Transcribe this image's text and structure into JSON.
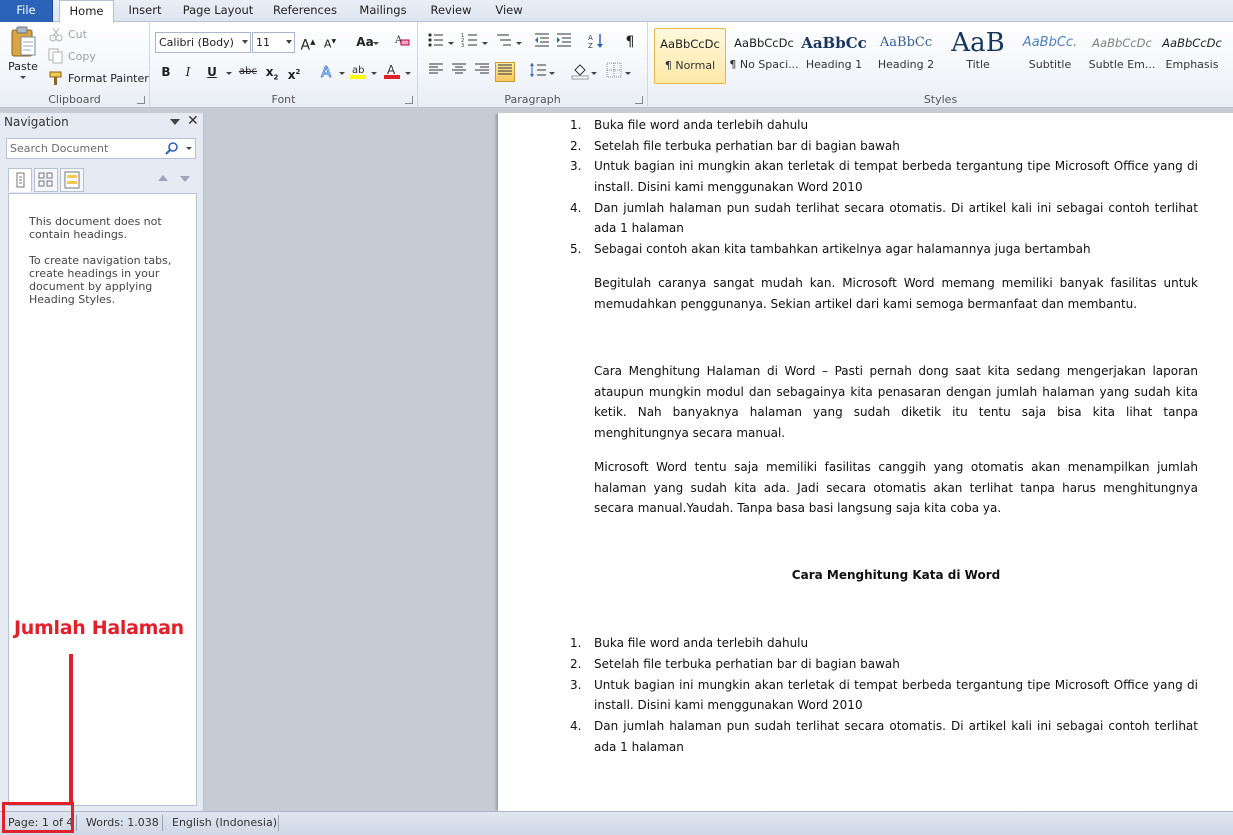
{
  "tabs": [
    {
      "label": "File"
    },
    {
      "label": "Home"
    },
    {
      "label": "Insert"
    },
    {
      "label": "Page Layout"
    },
    {
      "label": "References"
    },
    {
      "label": "Mailings"
    },
    {
      "label": "Review"
    },
    {
      "label": "View"
    }
  ],
  "clipboard": {
    "paste": "Paste",
    "cut": "Cut",
    "copy": "Copy",
    "format_painter": "Format Painter",
    "label": "Clipboard"
  },
  "font": {
    "family": "Calibri (Body)",
    "size": "11",
    "grow": "A",
    "shrink": "A",
    "change_case": "Aa",
    "bold": "B",
    "italic": "I",
    "underline": "U",
    "strike": "abc",
    "subscript": "x",
    "superscript": "x",
    "highlight_color": "#ffff00",
    "font_color": "#e0202a",
    "label": "Font"
  },
  "paragraph": {
    "label": "Paragraph",
    "pilcrow": "¶"
  },
  "styles": {
    "label": "Styles",
    "items": [
      {
        "sample": "AaBbCcDc",
        "name": "¶ Normal"
      },
      {
        "sample": "AaBbCcDc",
        "name": "¶ No Spaci..."
      },
      {
        "sample": "AaBbCc",
        "name": "Heading 1"
      },
      {
        "sample": "AaBbCc",
        "name": "Heading 2"
      },
      {
        "sample": "AaB",
        "name": "Title"
      },
      {
        "sample": "AaBbCc.",
        "name": "Subtitle"
      },
      {
        "sample": "AaBbCcDc",
        "name": "Subtle Em..."
      },
      {
        "sample": "AaBbCcDc",
        "name": "Emphasis"
      }
    ]
  },
  "navigation": {
    "title": "Navigation",
    "search_placeholder": "Search Document",
    "message1": "This document does not contain headings.",
    "message2": "To create navigation tabs, create headings in your document by applying Heading Styles."
  },
  "document": {
    "list1": [
      {
        "num": "1.",
        "text": "Buka file word anda terlebih dahulu"
      },
      {
        "num": "2.",
        "text": "Setelah file terbuka perhatian bar di bagian bawah"
      },
      {
        "num": "3.",
        "text": "Untuk bagian ini mungkin akan terletak di tempat berbeda tergantung tipe Microsoft Office yang di install. Disini kami menggunakan Word 2010"
      },
      {
        "num": "4.",
        "text": "Dan jumlah halaman pun sudah terlihat secara otomatis. Di artikel kali ini sebagai contoh terlihat ada 1 halaman"
      },
      {
        "num": "5.",
        "text": "Sebagai contoh akan kita tambahkan artikelnya agar halamannya juga bertambah"
      }
    ],
    "para1": "Begitulah caranya sangat mudah kan. Microsoft Word memang memiliki banyak fasilitas untuk memudahkan penggunanya. Sekian artikel dari kami semoga bermanfaat dan membantu.",
    "para2": "Cara Menghitung Halaman di Word – Pasti pernah dong saat kita sedang mengerjakan laporan ataupun mungkin modul dan sebagainya kita penasaran dengan jumlah halaman yang sudah kita ketik. Nah banyaknya halaman yang sudah diketik itu tentu saja bisa kita lihat tanpa menghitungnya secara manual.",
    "para3": "Microsoft Word tentu saja memiliki  fasilitas canggih yang otomatis akan menampilkan jumlah halaman yang sudah kita ada. Jadi secara otomatis akan terlihat tanpa harus menghitungnya secara manual.Yaudah. Tanpa basa basi langsung saja kita coba ya.",
    "heading": "Cara Menghitung Kata di Word",
    "list2": [
      {
        "num": "1.",
        "text": "Buka file word anda terlebih dahulu"
      },
      {
        "num": "2.",
        "text": "Setelah file terbuka perhatian bar di bagian bawah"
      },
      {
        "num": "3.",
        "text": "Untuk bagian ini mungkin akan terletak di tempat berbeda tergantung tipe Microsoft Office yang di install. Disini kami menggunakan Word 2010"
      },
      {
        "num": "4.",
        "text": "Dan jumlah halaman pun sudah terlihat secara otomatis. Di artikel kali ini sebagai contoh terlihat ada 1 halaman"
      }
    ]
  },
  "status": {
    "page": "Page: 1 of 4",
    "words": "Words: 1.038",
    "language": "English (Indonesia)"
  },
  "annotation": {
    "label": "Jumlah Halaman",
    "color": "#e0202a"
  }
}
